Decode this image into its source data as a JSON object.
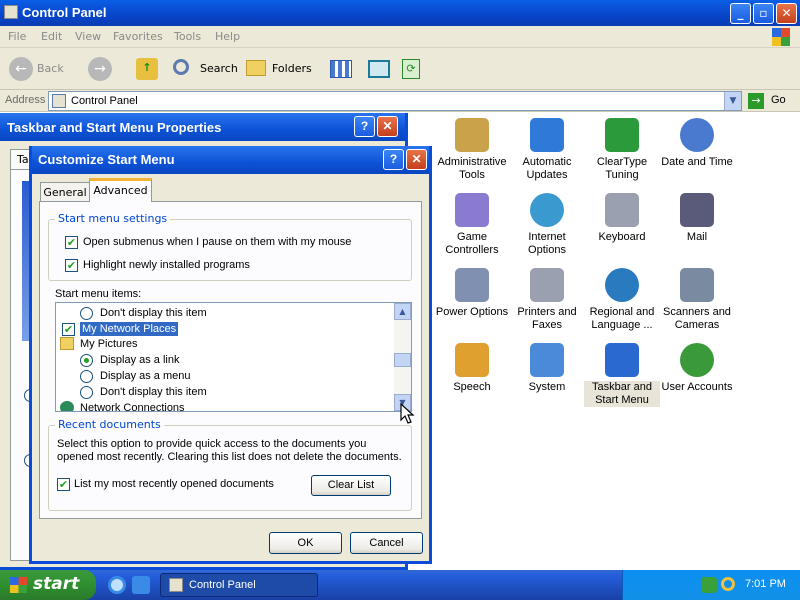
{
  "window": {
    "title": "Control Panel"
  },
  "menu": [
    "File",
    "Edit",
    "View",
    "Favorites",
    "Tools",
    "Help"
  ],
  "toolbar": {
    "back": "Back",
    "search": "Search",
    "folders": "Folders"
  },
  "address": {
    "label": "Address",
    "value": "Control Panel",
    "go": "Go"
  },
  "icons": [
    {
      "label": "Administrative Tools",
      "color": "#c9a24a"
    },
    {
      "label": "Automatic Updates",
      "color": "#2f7ad8"
    },
    {
      "label": "ClearType Tuning",
      "color": "#2a9a3a"
    },
    {
      "label": "Date and Time",
      "color": "#4a7ad0"
    },
    {
      "label": "Game Controllers",
      "color": "#8a7ad0"
    },
    {
      "label": "Internet Options",
      "color": "#3a9ad0"
    },
    {
      "label": "Keyboard",
      "color": "#9aa0b0"
    },
    {
      "label": "Mail",
      "color": "#5a5a7a"
    },
    {
      "label": "Power Options",
      "color": "#8090b0"
    },
    {
      "label": "Printers and Faxes",
      "color": "#9aa0b0"
    },
    {
      "label": "Regional and Language ...",
      "color": "#2a7ac0"
    },
    {
      "label": "Scanners and Cameras",
      "color": "#7a8aa0"
    },
    {
      "label": "Speech",
      "color": "#e0a030"
    },
    {
      "label": "System",
      "color": "#4a8ad8"
    },
    {
      "label": "Taskbar and Start Menu",
      "color": "#2a6ad0"
    },
    {
      "label": "User Accounts",
      "color": "#3a9a3a"
    }
  ],
  "props_dialog": {
    "title": "Taskbar and Start Menu Properties",
    "tab_stub": "Ta"
  },
  "dialog": {
    "title": "Customize Start Menu",
    "tabs": [
      "General",
      "Advanced"
    ],
    "settings_group": "Start menu settings",
    "opt1": "Open submenus when I pause on them with my mouse",
    "opt2": "Highlight newly installed programs",
    "items_label": "Start menu items:",
    "list": [
      "Don't display this item",
      "My Network Places",
      "My Pictures",
      "Display as a link",
      "Display as a menu",
      "Don't display this item",
      "Network Connections"
    ],
    "recent_group": "Recent documents",
    "recent_desc1": "Select this option to provide quick access to the documents you",
    "recent_desc2": "opened most recently.  Clearing this list does not delete the documents.",
    "recent_opt": "List my most recently opened documents",
    "clear": "Clear List",
    "ok": "OK",
    "cancel": "Cancel"
  },
  "taskbar": {
    "start": "start",
    "task": "Control Panel",
    "clock": "7:01 PM"
  }
}
